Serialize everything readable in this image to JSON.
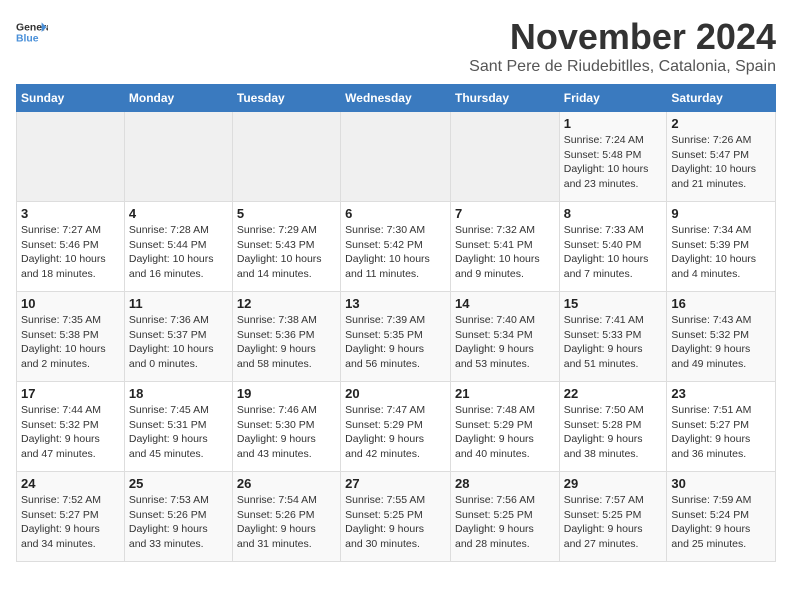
{
  "header": {
    "logo_general": "General",
    "logo_blue": "Blue",
    "month_title": "November 2024",
    "location": "Sant Pere de Riudebitlles, Catalonia, Spain"
  },
  "weekdays": [
    "Sunday",
    "Monday",
    "Tuesday",
    "Wednesday",
    "Thursday",
    "Friday",
    "Saturday"
  ],
  "weeks": [
    [
      {
        "day": "",
        "info": ""
      },
      {
        "day": "",
        "info": ""
      },
      {
        "day": "",
        "info": ""
      },
      {
        "day": "",
        "info": ""
      },
      {
        "day": "",
        "info": ""
      },
      {
        "day": "1",
        "info": "Sunrise: 7:24 AM\nSunset: 5:48 PM\nDaylight: 10 hours\nand 23 minutes."
      },
      {
        "day": "2",
        "info": "Sunrise: 7:26 AM\nSunset: 5:47 PM\nDaylight: 10 hours\nand 21 minutes."
      }
    ],
    [
      {
        "day": "3",
        "info": "Sunrise: 7:27 AM\nSunset: 5:46 PM\nDaylight: 10 hours\nand 18 minutes."
      },
      {
        "day": "4",
        "info": "Sunrise: 7:28 AM\nSunset: 5:44 PM\nDaylight: 10 hours\nand 16 minutes."
      },
      {
        "day": "5",
        "info": "Sunrise: 7:29 AM\nSunset: 5:43 PM\nDaylight: 10 hours\nand 14 minutes."
      },
      {
        "day": "6",
        "info": "Sunrise: 7:30 AM\nSunset: 5:42 PM\nDaylight: 10 hours\nand 11 minutes."
      },
      {
        "day": "7",
        "info": "Sunrise: 7:32 AM\nSunset: 5:41 PM\nDaylight: 10 hours\nand 9 minutes."
      },
      {
        "day": "8",
        "info": "Sunrise: 7:33 AM\nSunset: 5:40 PM\nDaylight: 10 hours\nand 7 minutes."
      },
      {
        "day": "9",
        "info": "Sunrise: 7:34 AM\nSunset: 5:39 PM\nDaylight: 10 hours\nand 4 minutes."
      }
    ],
    [
      {
        "day": "10",
        "info": "Sunrise: 7:35 AM\nSunset: 5:38 PM\nDaylight: 10 hours\nand 2 minutes."
      },
      {
        "day": "11",
        "info": "Sunrise: 7:36 AM\nSunset: 5:37 PM\nDaylight: 10 hours\nand 0 minutes."
      },
      {
        "day": "12",
        "info": "Sunrise: 7:38 AM\nSunset: 5:36 PM\nDaylight: 9 hours\nand 58 minutes."
      },
      {
        "day": "13",
        "info": "Sunrise: 7:39 AM\nSunset: 5:35 PM\nDaylight: 9 hours\nand 56 minutes."
      },
      {
        "day": "14",
        "info": "Sunrise: 7:40 AM\nSunset: 5:34 PM\nDaylight: 9 hours\nand 53 minutes."
      },
      {
        "day": "15",
        "info": "Sunrise: 7:41 AM\nSunset: 5:33 PM\nDaylight: 9 hours\nand 51 minutes."
      },
      {
        "day": "16",
        "info": "Sunrise: 7:43 AM\nSunset: 5:32 PM\nDaylight: 9 hours\nand 49 minutes."
      }
    ],
    [
      {
        "day": "17",
        "info": "Sunrise: 7:44 AM\nSunset: 5:32 PM\nDaylight: 9 hours\nand 47 minutes."
      },
      {
        "day": "18",
        "info": "Sunrise: 7:45 AM\nSunset: 5:31 PM\nDaylight: 9 hours\nand 45 minutes."
      },
      {
        "day": "19",
        "info": "Sunrise: 7:46 AM\nSunset: 5:30 PM\nDaylight: 9 hours\nand 43 minutes."
      },
      {
        "day": "20",
        "info": "Sunrise: 7:47 AM\nSunset: 5:29 PM\nDaylight: 9 hours\nand 42 minutes."
      },
      {
        "day": "21",
        "info": "Sunrise: 7:48 AM\nSunset: 5:29 PM\nDaylight: 9 hours\nand 40 minutes."
      },
      {
        "day": "22",
        "info": "Sunrise: 7:50 AM\nSunset: 5:28 PM\nDaylight: 9 hours\nand 38 minutes."
      },
      {
        "day": "23",
        "info": "Sunrise: 7:51 AM\nSunset: 5:27 PM\nDaylight: 9 hours\nand 36 minutes."
      }
    ],
    [
      {
        "day": "24",
        "info": "Sunrise: 7:52 AM\nSunset: 5:27 PM\nDaylight: 9 hours\nand 34 minutes."
      },
      {
        "day": "25",
        "info": "Sunrise: 7:53 AM\nSunset: 5:26 PM\nDaylight: 9 hours\nand 33 minutes."
      },
      {
        "day": "26",
        "info": "Sunrise: 7:54 AM\nSunset: 5:26 PM\nDaylight: 9 hours\nand 31 minutes."
      },
      {
        "day": "27",
        "info": "Sunrise: 7:55 AM\nSunset: 5:25 PM\nDaylight: 9 hours\nand 30 minutes."
      },
      {
        "day": "28",
        "info": "Sunrise: 7:56 AM\nSunset: 5:25 PM\nDaylight: 9 hours\nand 28 minutes."
      },
      {
        "day": "29",
        "info": "Sunrise: 7:57 AM\nSunset: 5:25 PM\nDaylight: 9 hours\nand 27 minutes."
      },
      {
        "day": "30",
        "info": "Sunrise: 7:59 AM\nSunset: 5:24 PM\nDaylight: 9 hours\nand 25 minutes."
      }
    ]
  ]
}
